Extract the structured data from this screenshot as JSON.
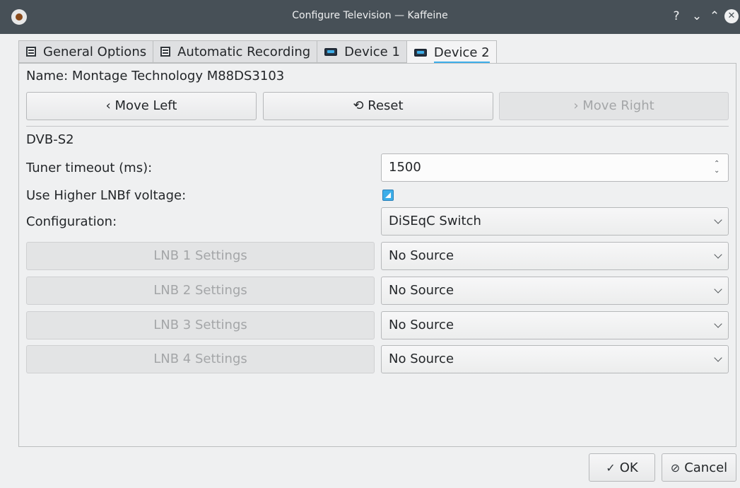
{
  "window": {
    "title": "Configure Television — Kaffeine",
    "controls": {
      "help": "?",
      "minimize": "⌄",
      "maximize": "⌃",
      "close": "✕"
    }
  },
  "tabs": [
    {
      "label": "General Options",
      "icon": "document-icon"
    },
    {
      "label": "Automatic Recording",
      "icon": "document-icon"
    },
    {
      "label": "Device 1",
      "icon": "tv-icon"
    },
    {
      "label": "Device 2",
      "icon": "tv-icon",
      "active": true
    }
  ],
  "device": {
    "name_text": "Name: Montage Technology M88DS3103",
    "move_left_label": "‹ Move Left",
    "reset_label": "⟲ Reset",
    "move_right_label": "› Move Right",
    "section_title": "DVB-S2",
    "tuner_timeout_label": "Tuner timeout (ms):",
    "tuner_timeout_value": "1500",
    "higher_lnbf_label": "Use Higher LNBf voltage:",
    "higher_lnbf_checked": true,
    "configuration_label": "Configuration:",
    "configuration_value": "DiSEqC Switch",
    "lnb_rows": [
      {
        "button_label": "LNB 1 Settings",
        "source": "No Source"
      },
      {
        "button_label": "LNB 2 Settings",
        "source": "No Source"
      },
      {
        "button_label": "LNB 3 Settings",
        "source": "No Source"
      },
      {
        "button_label": "LNB 4 Settings",
        "source": "No Source"
      }
    ]
  },
  "dialog": {
    "ok_label": "OK",
    "cancel_label": "Cancel"
  },
  "colors": {
    "titlebar": "#475057",
    "accent": "#3daee9",
    "window_bg": "#eff0f1"
  }
}
